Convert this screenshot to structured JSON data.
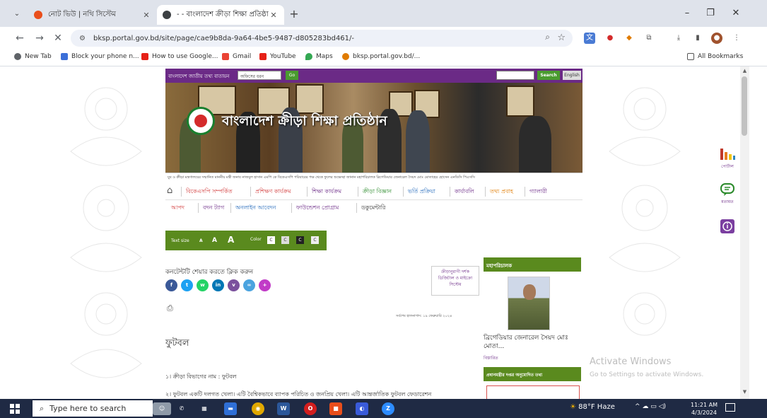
{
  "browser": {
    "tabs": [
      {
        "title": "নোট ভিউ | নথি সিস্টেম",
        "active": false
      },
      {
        "title": "- - বাংলাদেশ ক্রীড়া শিক্ষা প্রতিষ্ঠা",
        "active": true
      }
    ],
    "new_tab_symbol": "+",
    "url": "bksp.portal.gov.bd/site/page/cae9b8da-9a64-4be5-9487-d805283bd461/-",
    "bookmarks": [
      {
        "label": "New Tab",
        "icon": "globe-icon"
      },
      {
        "label": "Block your phone n...",
        "icon": "bookmark-icon"
      },
      {
        "label": "How to use Google...",
        "icon": "youtube-icon"
      },
      {
        "label": "Gmail",
        "icon": "gmail-icon"
      },
      {
        "label": "YouTube",
        "icon": "youtube-icon"
      },
      {
        "label": "Maps",
        "icon": "maps-icon"
      },
      {
        "label": "bksp.portal.gov.bd/...",
        "icon": "site-icon"
      }
    ],
    "all_bookmarks": "All Bookmarks"
  },
  "site": {
    "topbar_label": "বাংলাদেশ জাতীয় তথ্য বাতায়ন",
    "site_select": "অফিসের ধরন",
    "go": "Go",
    "search_button": "Search",
    "english_button": "English",
    "site_name": "বাংলাদেশ ক্রীড়া শিক্ষা প্রতিষ্ঠান",
    "ticker": "যুব ও ক্রীড়া মন্ত্রণালয়ের সম্মানিত মাননীয় মন্ত্রী জনাব নাজমুল হাসান এমপি কে বিকেএসপি পরিবারের পক্ষ থেকে ফুলের শুভেচ্ছা জানান মহাপরিচালক ব্রিগেডিয়ার জেনারেল সৈয়দ মোঃ মোতাহের হোসেন এনডিসি পিএসসি",
    "menu_row1": [
      "বিকেএসপি সম্পর্কিত",
      "প্রশিক্ষণ কার্যক্রম",
      "শিক্ষা কার্যক্রম",
      "ক্রীড়া বিজ্ঞান",
      "ভর্তি প্রক্রিয়া",
      "কার্যাবলি",
      "তথ্য প্রবাহ",
      "গ্যালারী"
    ],
    "menu_row2": [
      "আপদ",
      "বদন ট্যাগ",
      "অনলাইন আবেদন",
      "ফাউন্ডেশন প্রোগ্রাম",
      "ডকুমেন্টারি"
    ],
    "text_size_label": "Text size",
    "text_sizes": [
      "A",
      "A",
      "A"
    ],
    "color_label": "Color",
    "color_options": [
      "C",
      "C",
      "C",
      "C"
    ],
    "share_title": "কনটেন্টটি শেয়ার করতে ক্লিক করুন",
    "social": [
      {
        "name": "facebook",
        "color": "#3b5998",
        "glyph": "f"
      },
      {
        "name": "twitter",
        "color": "#1da1f2",
        "glyph": "t"
      },
      {
        "name": "whatsapp",
        "color": "#25d366",
        "glyph": "w"
      },
      {
        "name": "linkedin",
        "color": "#0077b5",
        "glyph": "in"
      },
      {
        "name": "viber",
        "color": "#7b519d",
        "glyph": "v"
      },
      {
        "name": "link",
        "color": "#4aa3df",
        "glyph": "∞"
      },
      {
        "name": "more",
        "color": "#c13bc7",
        "glyph": "+"
      }
    ],
    "widget_text": "ক্রীড়ানুরাগী দর্শক ডিজিটাল ও মাইক্রো সিস্টেম",
    "date_text": "সর্বশেষ হালনাগাদ: ১৯ ফেব্রুয়ারি ২০২৪",
    "page_heading": "ফুটবল",
    "item1": "১।   ক্রীড়া বিভাগের নাম : ফুটবল",
    "item2": "২।   ফুটবল একটি দলগত খেলা। এটি বৈশ্বিকভাবে ব্যাপক পরিচিত ও জনপ্রিয় খেলা। এটি আন্তর্জাতিক ফুটবল ফেডারেশন",
    "sidebar_title": "মহাপরিচালক",
    "dg_name": "ব্রিগেডিয়ার জেনারেল সৈয়দ মোঃ মোতা...",
    "dg_detail": "বিস্তারিত",
    "sidebar_title2": "প্রধানমন্ত্রীর দপ্তর অনুমোদিত তথ্য",
    "right_widgets": [
      "পোর্টাল",
      "মতামত"
    ]
  },
  "watermark": {
    "line1": "Activate Windows",
    "line2": "Go to Settings to activate Windows."
  },
  "taskbar": {
    "search_placeholder": "Type here to search",
    "weather": "88°F Haze",
    "time": "11:21 AM",
    "date": "4/3/2024"
  }
}
